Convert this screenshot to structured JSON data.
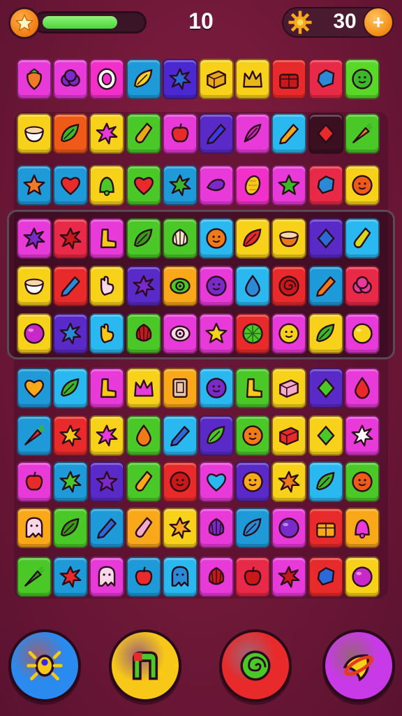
{
  "hud": {
    "score": "10",
    "coins": "30",
    "add_coin_symbol": "+",
    "progress_fraction": 0.72,
    "progress_color": "#4cd43a"
  },
  "board": {
    "rows": [
      [
        {
          "color": "#e83ad8",
          "icon": "strawberry",
          "fg": "#f07a2a"
        },
        {
          "color": "#e83ad8",
          "icon": "berry",
          "fg": "#7a2ac8"
        },
        {
          "color": "#f030c8",
          "icon": "ring",
          "fg": "#ffffff"
        },
        {
          "color": "#1e9ad8",
          "icon": "leaf",
          "fg": "#f2d21a"
        },
        {
          "color": "#4a2ad0",
          "icon": "splat",
          "fg": "#2a6ad8"
        },
        {
          "color": "#f8d21a",
          "icon": "block",
          "fg": "#e8a818"
        },
        {
          "color": "#f8d21a",
          "icon": "crown",
          "fg": "#e8b818"
        },
        {
          "color": "#e82a2a",
          "icon": "chest",
          "fg": "#c81818"
        },
        {
          "color": "#e82a48",
          "icon": "gem",
          "fg": "#2a8ad8"
        },
        {
          "color": "#5ad82a",
          "icon": "face",
          "fg": "#3ab828"
        }
      ],
      [
        {
          "color": "#f8d21a",
          "icon": "bowl",
          "fg": "#ffffff"
        },
        {
          "color": "#f05a18",
          "icon": "leaf",
          "fg": "#3ab828"
        },
        {
          "color": "#f8d21a",
          "icon": "splat",
          "fg": "#e83ad8"
        },
        {
          "color": "#4ac828",
          "icon": "bottle",
          "fg": "#e8a818"
        },
        {
          "color": "#e83ad8",
          "icon": "apple",
          "fg": "#e82a2a"
        },
        {
          "color": "#5a2ac8",
          "icon": "pencil",
          "fg": "#3a3ae8"
        },
        {
          "color": "#e83ad8",
          "icon": "feather",
          "fg": "#c828b8"
        },
        {
          "color": "#2ab8f0",
          "icon": "pencil",
          "fg": "#f0a818"
        },
        {
          "color": "#3a1020",
          "icon": "diamond",
          "fg": "#e82a2a"
        },
        {
          "color": "#4ac828",
          "icon": "carrot",
          "fg": "#f07a18"
        }
      ],
      [
        {
          "color": "#1e9ad8",
          "icon": "star",
          "fg": "#f07a2a"
        },
        {
          "color": "#1e9ad8",
          "icon": "heart",
          "fg": "#e82a2a"
        },
        {
          "color": "#f8d21a",
          "icon": "bell",
          "fg": "#4ac828"
        },
        {
          "color": "#4ac828",
          "icon": "heart",
          "fg": "#e82a2a"
        },
        {
          "color": "#1e9ad8",
          "icon": "splat",
          "fg": "#3ab828"
        },
        {
          "color": "#e83ad8",
          "icon": "pepper",
          "fg": "#7a2ac8"
        },
        {
          "color": "#f030c8",
          "icon": "corn",
          "fg": "#f8c818"
        },
        {
          "color": "#e83ad8",
          "icon": "star",
          "fg": "#3ab828"
        },
        {
          "color": "#e82a48",
          "icon": "gem",
          "fg": "#2a8ad8"
        },
        {
          "color": "#f8d21a",
          "icon": "face",
          "fg": "#f05a18"
        }
      ],
      [
        {
          "color": "#e83ad8",
          "icon": "splat",
          "fg": "#7a2ac8"
        },
        {
          "color": "#e82a48",
          "icon": "splat",
          "fg": "#c81818"
        },
        {
          "color": "#e83ad8",
          "icon": "boot",
          "fg": "#f8c818"
        },
        {
          "color": "#4ac828",
          "icon": "leaf",
          "fg": "#3a9a18"
        },
        {
          "color": "#4ac828",
          "icon": "shell",
          "fg": "#f8e8c8"
        },
        {
          "color": "#2ab8f0",
          "icon": "face",
          "fg": "#f07a18"
        },
        {
          "color": "#f8d21a",
          "icon": "leaf",
          "fg": "#e82a2a"
        },
        {
          "color": "#f8d21a",
          "icon": "bowl",
          "fg": "#e8781a"
        },
        {
          "color": "#5a2ac8",
          "icon": "diamond",
          "fg": "#2a6ad8"
        },
        {
          "color": "#2ab8f0",
          "icon": "bottle",
          "fg": "#d8d81a"
        }
      ],
      [
        {
          "color": "#f8d21a",
          "icon": "bowl",
          "fg": "#ffffff"
        },
        {
          "color": "#e82a2a",
          "icon": "pencil",
          "fg": "#2a8ad8"
        },
        {
          "color": "#f8d21a",
          "icon": "hand",
          "fg": "#f8d8e8"
        },
        {
          "color": "#5a2ac8",
          "icon": "splat",
          "fg": "#7a2ac8"
        },
        {
          "color": "#f8a818",
          "icon": "eye",
          "fg": "#4ac828"
        },
        {
          "color": "#e83ad8",
          "icon": "face",
          "fg": "#7a2ac8"
        },
        {
          "color": "#2ab8f0",
          "icon": "drop",
          "fg": "#2a8ad8"
        },
        {
          "color": "#e82a2a",
          "icon": "swirl",
          "fg": "#c81818"
        },
        {
          "color": "#1e9ad8",
          "icon": "pencil",
          "fg": "#f07a18"
        },
        {
          "color": "#e82a48",
          "icon": "berry",
          "fg": "#e83a98"
        }
      ],
      [
        {
          "color": "#f8d21a",
          "icon": "ball",
          "fg": "#c828c8"
        },
        {
          "color": "#5a2ac8",
          "icon": "splat",
          "fg": "#2a8ad8"
        },
        {
          "color": "#2ab8f0",
          "icon": "hand",
          "fg": "#f8c818"
        },
        {
          "color": "#4ac828",
          "icon": "shell",
          "fg": "#c81818"
        },
        {
          "color": "#e83ad8",
          "icon": "eye",
          "fg": "#f8d8e8"
        },
        {
          "color": "#e83ad8",
          "icon": "star",
          "fg": "#f8d21a"
        },
        {
          "color": "#e82a2a",
          "icon": "citrus",
          "fg": "#4ac828"
        },
        {
          "color": "#e83ad8",
          "icon": "face",
          "fg": "#f8d21a"
        },
        {
          "color": "#f8d21a",
          "icon": "leaf",
          "fg": "#3ab828"
        },
        {
          "color": "#e83ad8",
          "icon": "ball",
          "fg": "#f8d21a"
        }
      ],
      [
        {
          "color": "#1e9ad8",
          "icon": "heart",
          "fg": "#f8a818"
        },
        {
          "color": "#2ab8f0",
          "icon": "leaf",
          "fg": "#3ab828"
        },
        {
          "color": "#e83ad8",
          "icon": "boot",
          "fg": "#f8c818"
        },
        {
          "color": "#f8d21a",
          "icon": "crown",
          "fg": "#e83ad8"
        },
        {
          "color": "#f8a818",
          "icon": "door",
          "fg": "#e8c8a8"
        },
        {
          "color": "#2ab8f0",
          "icon": "face",
          "fg": "#7a2ac8"
        },
        {
          "color": "#4ac828",
          "icon": "boot",
          "fg": "#f8c818"
        },
        {
          "color": "#f8d21a",
          "icon": "block",
          "fg": "#f8a8c8"
        },
        {
          "color": "#5a2ac8",
          "icon": "diamond",
          "fg": "#4ac828"
        },
        {
          "color": "#e83ad8",
          "icon": "drop",
          "fg": "#e82a2a"
        }
      ],
      [
        {
          "color": "#1e9ad8",
          "icon": "carrot",
          "fg": "#e82a2a"
        },
        {
          "color": "#e82a2a",
          "icon": "splat",
          "fg": "#f8c818"
        },
        {
          "color": "#f8d21a",
          "icon": "splat",
          "fg": "#e83ad8"
        },
        {
          "color": "#4ac828",
          "icon": "drop",
          "fg": "#f07a18"
        },
        {
          "color": "#2ab8f0",
          "icon": "pencil",
          "fg": "#2a6ad8"
        },
        {
          "color": "#5a2ac8",
          "icon": "leaf",
          "fg": "#4ac828"
        },
        {
          "color": "#4ac828",
          "icon": "face",
          "fg": "#f07a18"
        },
        {
          "color": "#f8d21a",
          "icon": "block",
          "fg": "#e82a2a"
        },
        {
          "color": "#f8d21a",
          "icon": "diamond",
          "fg": "#4ac828"
        },
        {
          "color": "#e83ad8",
          "icon": "splat",
          "fg": "#ffffff"
        }
      ],
      [
        {
          "color": "#e83ad8",
          "icon": "apple",
          "fg": "#e82a2a"
        },
        {
          "color": "#1e9ad8",
          "icon": "splat",
          "fg": "#4ac828"
        },
        {
          "color": "#5a2ac8",
          "icon": "star",
          "fg": "#7a2ac8"
        },
        {
          "color": "#4ac828",
          "icon": "bottle",
          "fg": "#f8a818"
        },
        {
          "color": "#e82a2a",
          "icon": "face",
          "fg": "#c81818"
        },
        {
          "color": "#e83ad8",
          "icon": "heart",
          "fg": "#2ab8f0"
        },
        {
          "color": "#5a2ac8",
          "icon": "face",
          "fg": "#f8a818"
        },
        {
          "color": "#f8d21a",
          "icon": "splat",
          "fg": "#f07a18"
        },
        {
          "color": "#2ab8f0",
          "icon": "leaf",
          "fg": "#3ab828"
        },
        {
          "color": "#4ac828",
          "icon": "face",
          "fg": "#f05a18"
        }
      ],
      [
        {
          "color": "#f8a818",
          "icon": "ghost",
          "fg": "#f8d8e8"
        },
        {
          "color": "#4ac828",
          "icon": "leaf",
          "fg": "#3a9a18"
        },
        {
          "color": "#1e9ad8",
          "icon": "pencil",
          "fg": "#2a6ad8"
        },
        {
          "color": "#f8a818",
          "icon": "bottle",
          "fg": "#f8a8c8"
        },
        {
          "color": "#f8d21a",
          "icon": "splat",
          "fg": "#f8a818"
        },
        {
          "color": "#e83ad8",
          "icon": "shell",
          "fg": "#7a2ac8"
        },
        {
          "color": "#1e9ad8",
          "icon": "leaf",
          "fg": "#2a8ad8"
        },
        {
          "color": "#e83ad8",
          "icon": "ball",
          "fg": "#7a2ac8"
        },
        {
          "color": "#e82a2a",
          "icon": "chest",
          "fg": "#f8a818"
        },
        {
          "color": "#f8a818",
          "icon": "bell",
          "fg": "#e83ad8"
        }
      ],
      [
        {
          "color": "#4ac828",
          "icon": "carrot",
          "fg": "#2a9a18"
        },
        {
          "color": "#1e9ad8",
          "icon": "splat",
          "fg": "#e82a2a"
        },
        {
          "color": "#e83ad8",
          "icon": "ghost",
          "fg": "#f8d8e8"
        },
        {
          "color": "#1e9ad8",
          "icon": "apple",
          "fg": "#e82a2a"
        },
        {
          "color": "#2ab8f0",
          "icon": "ghost",
          "fg": "#2a8ad8"
        },
        {
          "color": "#e83ad8",
          "icon": "shell",
          "fg": "#c81818"
        },
        {
          "color": "#e82a48",
          "icon": "apple",
          "fg": "#c81818"
        },
        {
          "color": "#e83ad8",
          "icon": "splat",
          "fg": "#c81818"
        },
        {
          "color": "#e82a2a",
          "icon": "gem",
          "fg": "#2a6ad8"
        },
        {
          "color": "#f8d21a",
          "icon": "ball",
          "fg": "#c828c8"
        }
      ]
    ]
  },
  "powerups": [
    {
      "name": "bug-powerup",
      "color": "#2a8af0",
      "icon": "bug"
    },
    {
      "name": "magnet-powerup",
      "color": "#f8c818",
      "icon": "magnet"
    },
    {
      "name": "swirl-powerup",
      "color": "#e82a2a",
      "icon": "swirl"
    },
    {
      "name": "rocket-powerup",
      "color": "#c83ae8",
      "icon": "rocket"
    }
  ]
}
